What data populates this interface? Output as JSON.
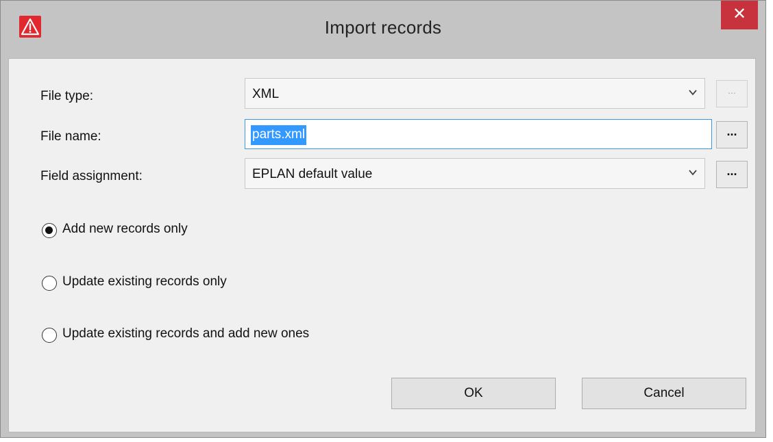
{
  "window": {
    "title": "Import records",
    "close_glyph": "✕",
    "app_icon": "eplan-warning-triangle-icon"
  },
  "form": {
    "file_type": {
      "label": "File type:",
      "value": "XML"
    },
    "file_name": {
      "label": "File name:",
      "value": "parts.xml"
    },
    "field_assignment": {
      "label": "Field assignment:",
      "value": "EPLAN default value"
    },
    "browse_label": "..."
  },
  "options": {
    "selected": "add_new_only",
    "items": [
      {
        "key": "add_new_only",
        "label": "Add new records only",
        "checked": true
      },
      {
        "key": "update_existing_only",
        "label": "Update existing records only",
        "checked": false
      },
      {
        "key": "update_and_add",
        "label": "Update existing records and add new ones",
        "checked": false
      }
    ]
  },
  "buttons": {
    "ok": "OK",
    "cancel": "Cancel"
  },
  "colors": {
    "close_button": "#c7323c",
    "selection": "#3399ff",
    "focus_border": "#3b97e3",
    "app_icon": "#e0282e"
  }
}
